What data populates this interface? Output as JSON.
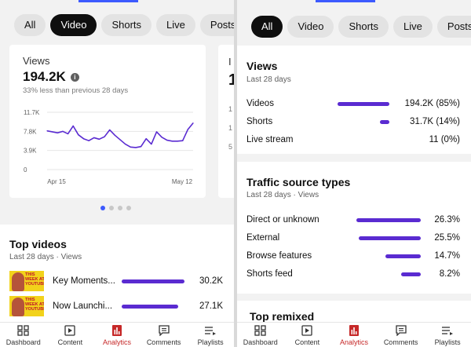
{
  "left": {
    "chips": [
      "All",
      "Video",
      "Shorts",
      "Live",
      "Posts"
    ],
    "active_chip": 1,
    "views_card": {
      "label": "Views",
      "value": "194.2K",
      "info_icon": "info-icon",
      "comparison": "33% less than previous 28 days",
      "y_ticks": [
        "11.7K",
        "7.8K",
        "3.9K",
        "0"
      ],
      "x_ticks": [
        "Apr 15",
        "May 12"
      ]
    },
    "next_card": {
      "label": "I",
      "value": "1",
      "ticks": [
        "1",
        "1",
        "5"
      ]
    },
    "carousel": {
      "count": 4,
      "active": 0
    },
    "top_videos": {
      "title": "Top videos",
      "subtitle": "Last 28 days · Views",
      "items": [
        {
          "title": "Key Moments...",
          "value": "30.2K",
          "fraction": 1.0,
          "thumb_text": "THIS WEEK AT YOUTUBE"
        },
        {
          "title": "Now Launchi...",
          "value": "27.1K",
          "fraction": 0.9,
          "thumb_text": "THIS WEEK AT YOUTUBE"
        }
      ]
    }
  },
  "chart_data": {
    "type": "line",
    "title": "",
    "xlabel": "",
    "ylabel": "",
    "x_tick_labels": [
      "Apr 15",
      "May 12"
    ],
    "y_tick_labels": [
      "11.7K",
      "7.8K",
      "3.9K",
      "0"
    ],
    "ylim": [
      0,
      11700
    ],
    "grid": true,
    "series": [
      {
        "values": [
          7900,
          7700,
          7500,
          7800,
          7300,
          8900,
          7100,
          6300,
          5900,
          6500,
          6200,
          6700,
          8100,
          7000,
          6100,
          5200,
          4600,
          4500,
          4700,
          6300,
          5200,
          7700,
          6600,
          6000,
          5800,
          5800,
          5900,
          8200,
          9500
        ]
      }
    ]
  },
  "right": {
    "chips": [
      "All",
      "Video",
      "Shorts",
      "Live",
      "Posts"
    ],
    "active_chip": 0,
    "views": {
      "title": "Views",
      "subtitle": "Last 28 days",
      "rows": [
        {
          "label": "Videos",
          "value": "194.2K",
          "pct": "(85%)",
          "fraction": 0.85
        },
        {
          "label": "Shorts",
          "value": "31.7K",
          "pct": "(14%)",
          "fraction": 0.14
        },
        {
          "label": "Live stream",
          "value": "11",
          "pct": "(0%)",
          "fraction": 0
        }
      ]
    },
    "traffic": {
      "title": "Traffic source types",
      "subtitle": "Last 28 days · Views",
      "rows": [
        {
          "label": "Direct or unknown",
          "value": "26.3%",
          "fraction": 0.263
        },
        {
          "label": "External",
          "value": "25.5%",
          "fraction": 0.255
        },
        {
          "label": "Browse features",
          "value": "14.7%",
          "fraction": 0.147
        },
        {
          "label": "Shorts feed",
          "value": "8.2%",
          "fraction": 0.082
        }
      ]
    },
    "remix": {
      "title": "Top remixed"
    }
  },
  "nav": {
    "items": [
      {
        "label": "Dashboard",
        "icon": "dashboard-icon"
      },
      {
        "label": "Content",
        "icon": "content-icon"
      },
      {
        "label": "Analytics",
        "icon": "analytics-icon"
      },
      {
        "label": "Comments",
        "icon": "comments-icon"
      },
      {
        "label": "Playlists",
        "icon": "playlists-icon"
      }
    ],
    "active": 2
  },
  "colors": {
    "accent": "#5a2bd1",
    "active_nav": "#c62828",
    "blue": "#3d5afe"
  }
}
